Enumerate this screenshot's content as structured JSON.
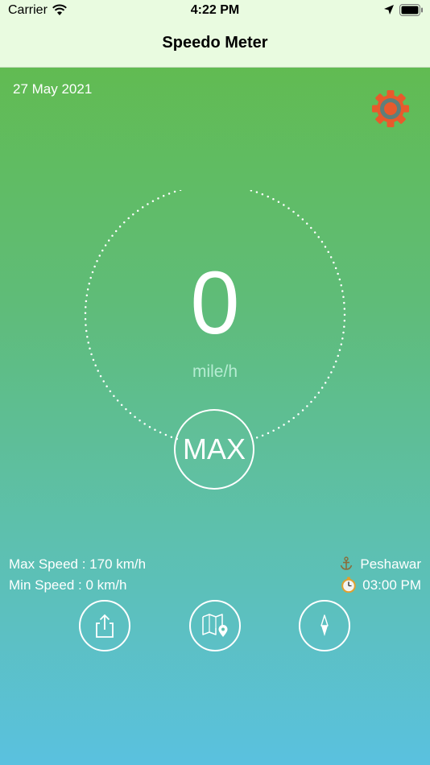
{
  "status_bar": {
    "carrier": "Carrier",
    "time": "4:22 PM",
    "icons": [
      "wifi-icon",
      "location-arrow-icon",
      "battery-icon"
    ]
  },
  "nav": {
    "title": "Speedo Meter"
  },
  "header": {
    "date": "27 May 2021",
    "settings_icon": "gear-icon"
  },
  "speedometer": {
    "speed": "0",
    "unit": "mile/h",
    "max_label": "MAX"
  },
  "stats": {
    "max_speed": "Max Speed : 170 km/h",
    "min_speed": "Min Speed : 0 km/h",
    "location": "Peshawar",
    "location_icon": "anchor-icon",
    "time": "03:00 PM",
    "time_icon": "stopwatch-icon"
  },
  "actions": [
    {
      "icon": "share-icon"
    },
    {
      "icon": "map-pin-icon"
    },
    {
      "icon": "compass-icon"
    }
  ],
  "colors": {
    "topbar": "#e9fbe0",
    "gradient_top": "#62bb47",
    "gradient_bottom": "#5ac1df",
    "gear": "#e85a2c",
    "gear_center": "#5e7f7a"
  }
}
